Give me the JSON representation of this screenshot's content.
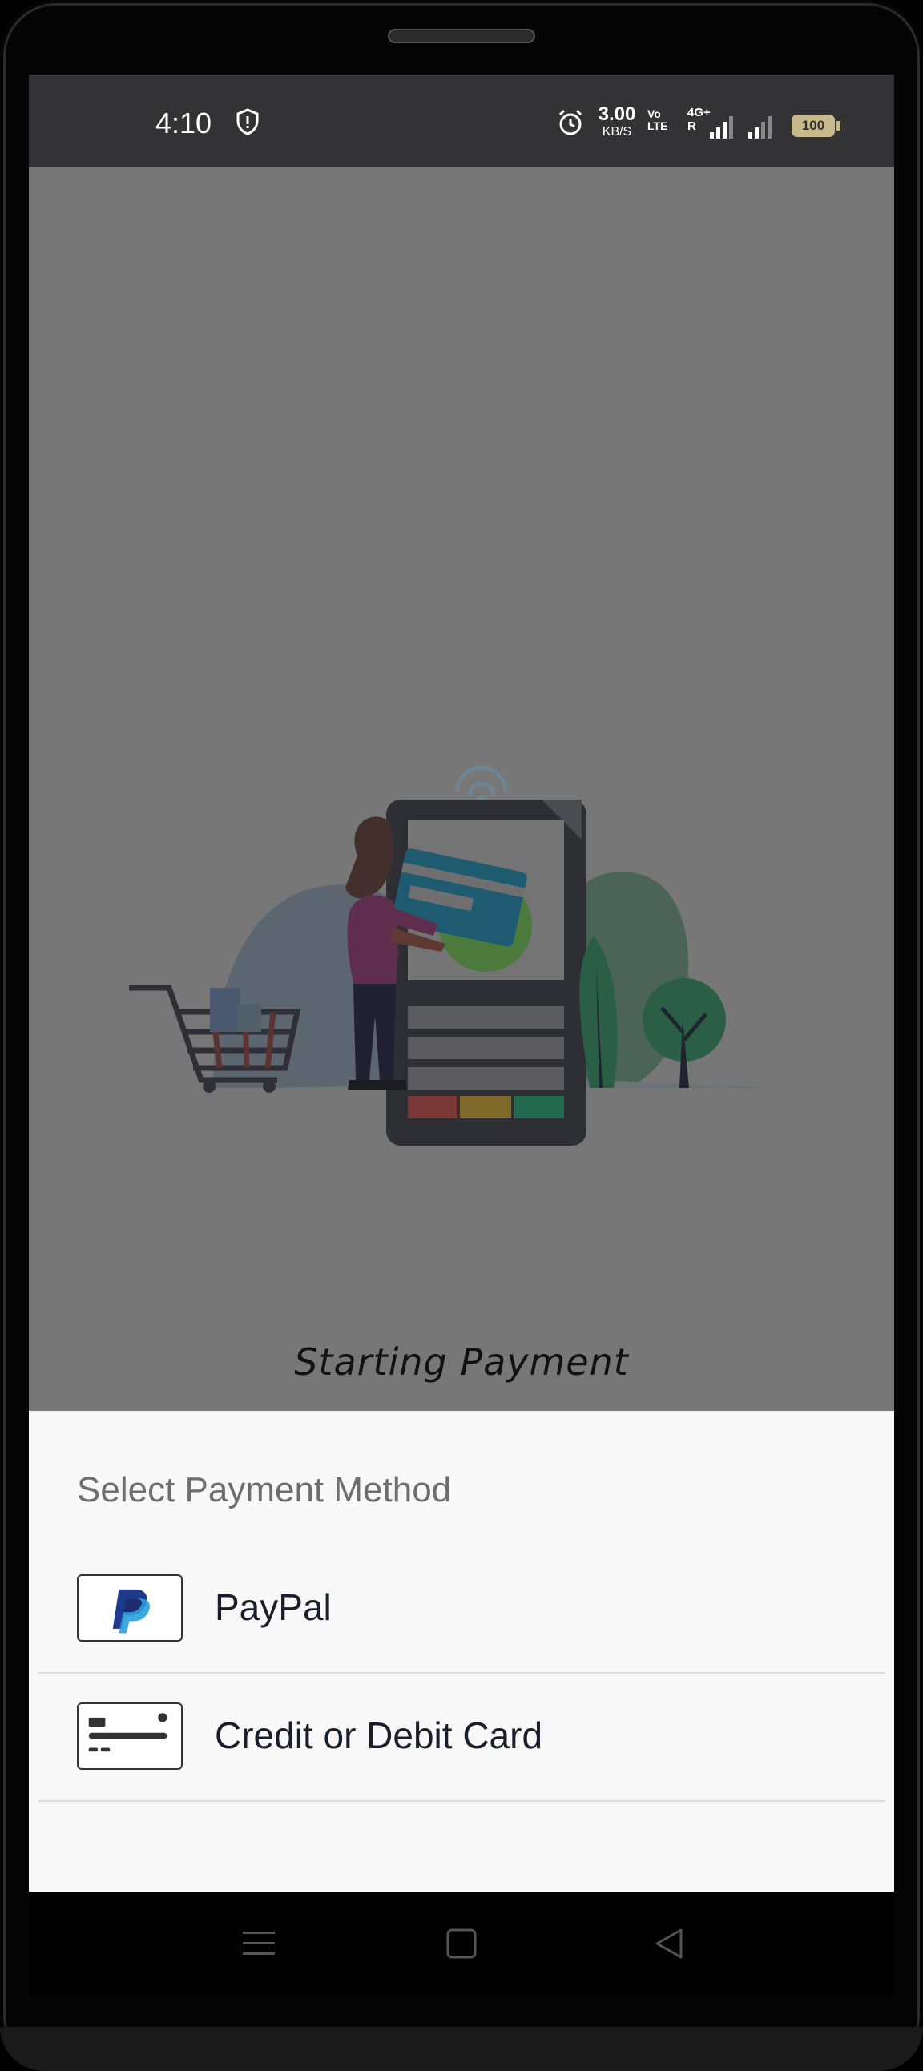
{
  "status_bar": {
    "time": "4:10",
    "net_speed_value": "3.00",
    "net_speed_unit": "KB/S",
    "volte_line1": "Vo",
    "volte_line2": "LTE",
    "network_type": "4G+",
    "roaming": "R",
    "battery_level": "100"
  },
  "screen": {
    "loading_text": "Starting Payment"
  },
  "payment_sheet": {
    "title": "Select Payment Method",
    "methods": [
      {
        "label": "PayPal",
        "icon": "paypal-logo-icon"
      },
      {
        "label": "Credit or Debit Card",
        "icon": "credit-card-icon"
      }
    ]
  },
  "nav_bar": {
    "menu": "menu-icon",
    "home": "home-square-icon",
    "back": "back-triangle-icon"
  },
  "colors": {
    "overlay": "#777777",
    "sheet_bg": "#f8f8f8",
    "paypal_dark": "#1f3a8c",
    "paypal_light": "#2a9fdc"
  }
}
